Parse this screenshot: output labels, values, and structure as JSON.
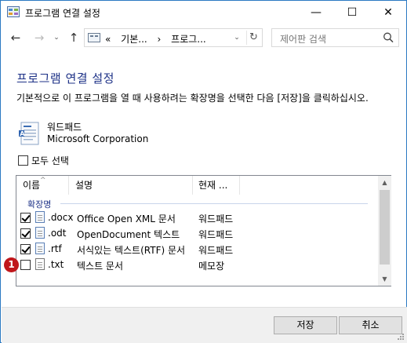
{
  "window": {
    "title": "프로그램 연결 설정",
    "controls": {
      "minimize": "—",
      "maximize": "☐",
      "close": "✕"
    }
  },
  "nav": {
    "back": "←",
    "forward": "→",
    "recent": "⌄",
    "up": "↑",
    "address": {
      "overflow": "«",
      "crumbs": [
        "기본...",
        "프로그..."
      ],
      "separator": "›",
      "dropdown": "⌄",
      "refresh": "↻"
    },
    "search": {
      "placeholder": "제어판 검색"
    }
  },
  "content": {
    "heading": "프로그램 연결 설정",
    "instruction": "기본적으로 이 프로그램을 열 때 사용하려는 확장명을 선택한 다음 [저장]을 클릭하십시오.",
    "app": {
      "name": "워드패드",
      "publisher": "Microsoft Corporation"
    },
    "select_all": {
      "label": "모두 선택",
      "checked": false
    }
  },
  "list": {
    "columns": {
      "name": "이름",
      "description": "설명",
      "current": "현재 ..."
    },
    "sort_indicator": "^",
    "group": "확장명",
    "rows": [
      {
        "ext": ".docx",
        "description": "Office Open XML 문서",
        "current": "워드패드",
        "checked": true
      },
      {
        "ext": ".odt",
        "description": "OpenDocument 텍스트",
        "current": "워드패드",
        "checked": true
      },
      {
        "ext": ".rtf",
        "description": "서식있는 텍스트(RTF) 문서",
        "current": "워드패드",
        "checked": true
      },
      {
        "ext": ".txt",
        "description": "텍스트 문서",
        "current": "메모장",
        "checked": false
      }
    ],
    "scroll_up": "▲",
    "scroll_down": "▼"
  },
  "annotation": {
    "badge": "1"
  },
  "footer": {
    "save": "저장",
    "cancel": "취소"
  },
  "colors": {
    "heading": "#1e3287",
    "border": "#2b79c2",
    "badge": "#c0171b"
  }
}
